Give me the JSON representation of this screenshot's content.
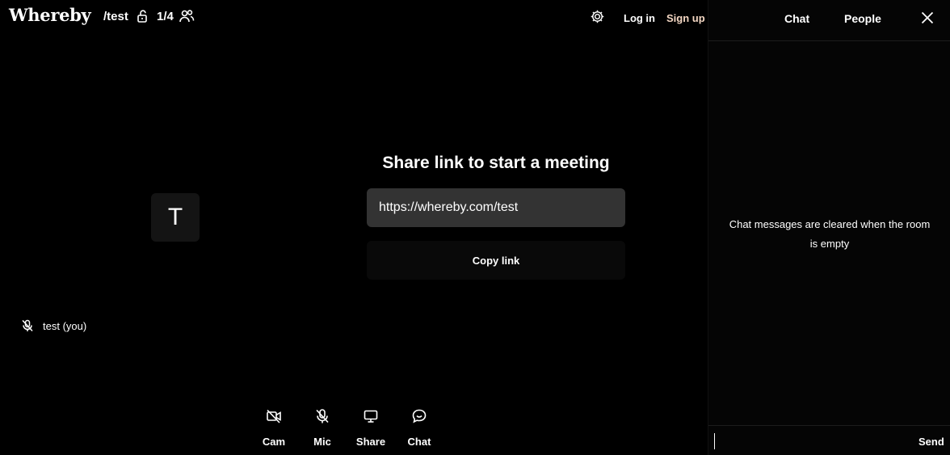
{
  "topbar": {
    "logo": "Whereby",
    "room_name": "/test",
    "occupancy": "1/4",
    "login_label": "Log in",
    "signup_label": "Sign up",
    "icons": [
      "lock-open-icon",
      "people-icon",
      "gear-icon"
    ]
  },
  "self_view": {
    "avatar_initial": "T",
    "name_label": "test (you)",
    "icon": "mic-muted-icon"
  },
  "share_panel": {
    "title": "Share link to start a meeting",
    "link_value": "https://whereby.com/test",
    "copy_label": "Copy link"
  },
  "toolbar": {
    "items": [
      {
        "label": "Cam",
        "icon": "camera-off-icon"
      },
      {
        "label": "Mic",
        "icon": "mic-muted-icon"
      },
      {
        "label": "Share",
        "icon": "screen-share-icon"
      },
      {
        "label": "Chat",
        "icon": "chat-bubble-icon"
      }
    ]
  },
  "side_panel": {
    "tabs": [
      {
        "label": "Chat"
      },
      {
        "label": "People"
      }
    ],
    "empty_message": "Chat messages are cleared when the room is empty",
    "input_placeholder": "",
    "send_label": "Send",
    "icon": "close-icon"
  },
  "colors": {
    "background": "#000000",
    "panel_background": "#050505",
    "input_background": "#333333",
    "avatar_background": "#141414",
    "signup_accent": "#f3d6c2"
  }
}
